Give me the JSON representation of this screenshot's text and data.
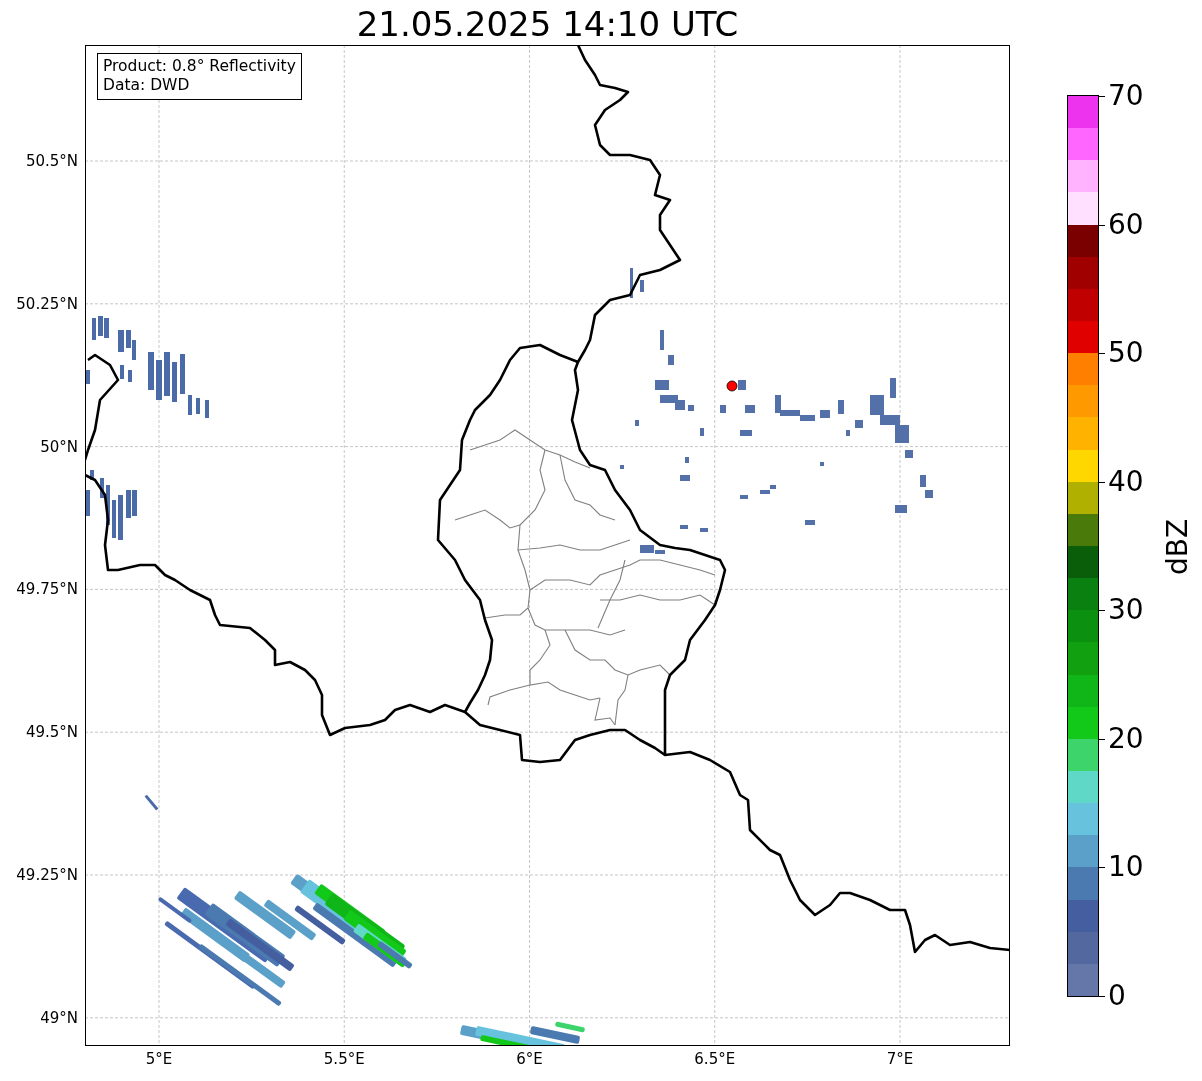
{
  "title": "21.05.2025 14:10 UTC",
  "info_box": [
    "Product: 0.8° Reflectivity",
    "Data: DWD"
  ],
  "map": {
    "y_ticks": [
      "50.5°N",
      "50.25°N",
      "50°N",
      "49.75°N",
      "49.5°N",
      "49.25°N",
      "49°N"
    ],
    "x_ticks": [
      "5°E",
      "5.5°E",
      "6°E",
      "6.5°E",
      "7°E"
    ]
  },
  "colorbar": {
    "label": "dBZ",
    "ticks": [
      "70",
      "60",
      "50",
      "40",
      "30",
      "20",
      "10",
      "0"
    ],
    "steps": [
      {
        "color": "#6577a8"
      },
      {
        "color": "#5468a0"
      },
      {
        "color": "#445ea0"
      },
      {
        "color": "#4a7ab0"
      },
      {
        "color": "#5aa0c8"
      },
      {
        "color": "#66c2dd"
      },
      {
        "color": "#60d8c8"
      },
      {
        "color": "#3dd46c"
      },
      {
        "color": "#12c818"
      },
      {
        "color": "#10b518"
      },
      {
        "color": "#10a010"
      },
      {
        "color": "#0c9010"
      },
      {
        "color": "#0a8010"
      },
      {
        "color": "#0a5e0a"
      },
      {
        "color": "#4a7a0a"
      },
      {
        "color": "#b0b000"
      },
      {
        "color": "#ffd700"
      },
      {
        "color": "#ffb300"
      },
      {
        "color": "#ff9900"
      },
      {
        "color": "#ff7f00"
      },
      {
        "color": "#e00000"
      },
      {
        "color": "#c00000"
      },
      {
        "color": "#a00000"
      },
      {
        "color": "#7a0000"
      },
      {
        "color": "#ffe0ff"
      },
      {
        "color": "#ffb3ff"
      },
      {
        "color": "#ff66ff"
      },
      {
        "color": "#ee33ee"
      }
    ]
  }
}
